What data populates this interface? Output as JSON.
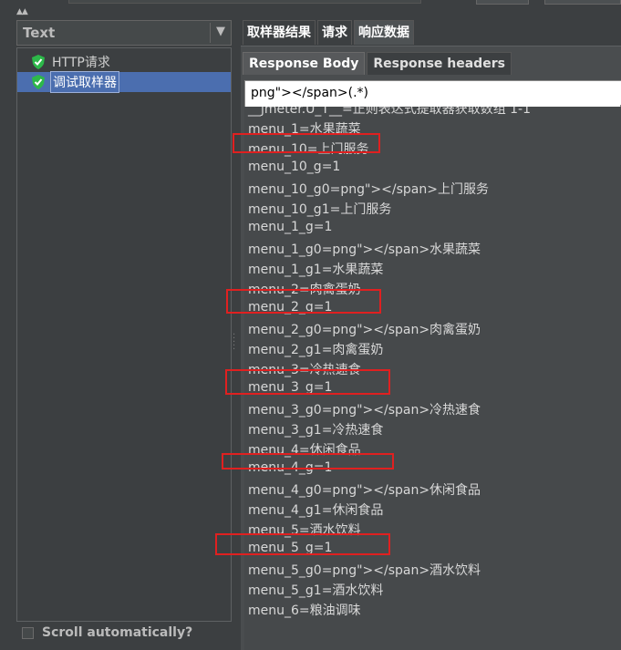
{
  "left": {
    "combo_label": "Text",
    "tree": [
      {
        "label": "HTTP请求",
        "selected": false
      },
      {
        "label": "调试取样器",
        "selected": true
      }
    ],
    "scroll_auto_label": "Scroll automatically?"
  },
  "tabs": [
    "取样器结果",
    "请求",
    "响应数据"
  ],
  "subtabs": [
    "Response Body",
    "Response headers"
  ],
  "search_value": "png\"></span>(.*)",
  "lines": [
    "__jmeter.U_T__=正则表达式提取器获取数组 1-1",
    "menu_1=水果蔬菜",
    "menu_10=上门服务",
    "menu_10_g=1",
    "menu_10_g0=png\"></span>上门服务",
    "menu_10_g1=上门服务",
    "menu_1_g=1",
    "menu_1_g0=png\"></span>水果蔬菜",
    "menu_1_g1=水果蔬菜",
    "menu_2=肉禽蛋奶",
    "menu_2_g=1",
    "menu_2_g0=png\"></span>肉禽蛋奶",
    "menu_2_g1=肉禽蛋奶",
    "menu_3=冷热速食",
    "menu_3_g=1",
    "menu_3_g0=png\"></span>冷热速食",
    "menu_3_g1=冷热速食",
    "menu_4=休闲食品",
    "menu_4_g=1",
    "menu_4_g0=png\"></span>休闲食品",
    "menu_4_g1=休闲食品",
    "menu_5=酒水饮料",
    "menu_5_g=1",
    "menu_5_g0=png\"></span>酒水饮料",
    "menu_5_g1=酒水饮料",
    "menu_6=粮油调味"
  ],
  "colors": {
    "highlight": "#e02020",
    "selection": "#4b6eaf"
  }
}
